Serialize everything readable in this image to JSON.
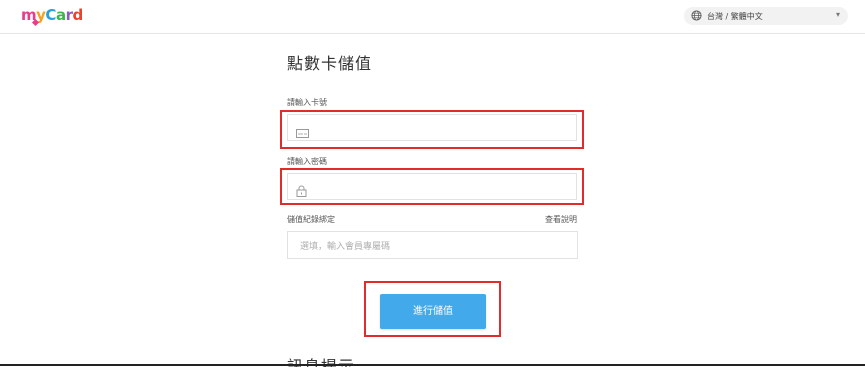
{
  "header": {
    "logo": {
      "m": "m",
      "y": "y",
      "c": "C",
      "a": "a",
      "r": "r",
      "d": "d"
    },
    "language": "台灣 / 繁體中文"
  },
  "form": {
    "title": "點數卡儲值",
    "card_number_label": "請輸入卡號",
    "card_number_value": "",
    "password_label": "請輸入密碼",
    "password_value": "",
    "binding_label": "儲值紀錄綁定",
    "help_link": "查看說明",
    "member_placeholder": "選填，輸入會員專屬碼",
    "submit_label": "進行儲值"
  },
  "info": {
    "title": "訊息提示"
  },
  "colors": {
    "highlight": "#e22b2b",
    "button": "#42a9ea"
  }
}
